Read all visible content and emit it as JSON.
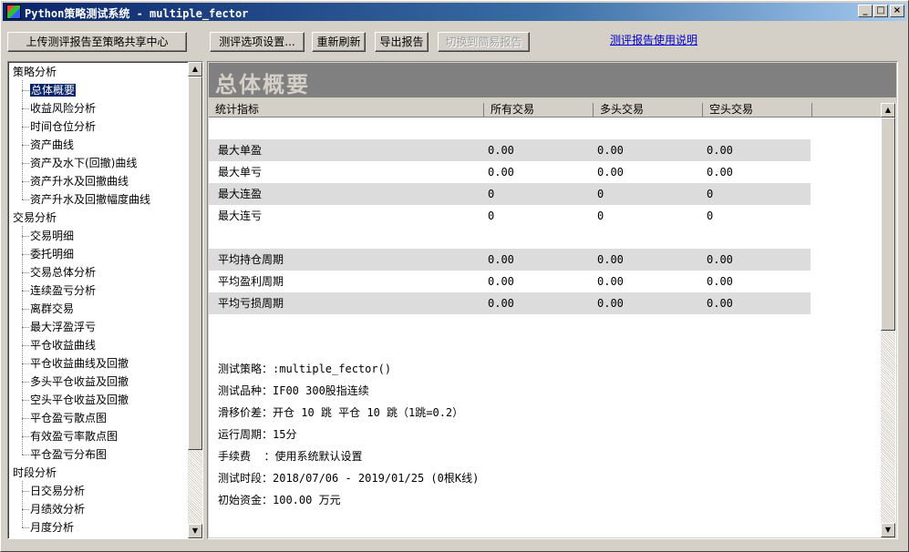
{
  "window": {
    "title": "Python策略测试系统 - multiple_fector"
  },
  "toolbar": {
    "upload_label": "上传测评报告至策略共享中心",
    "options_label": "测评选项设置...",
    "refresh_label": "重新刷新",
    "export_label": "导出报告",
    "simple_label": "切换到简易报告",
    "help_link": "测评报告使用说明"
  },
  "tree": {
    "groups": [
      {
        "label": "策略分析",
        "items": [
          "总体概要",
          "收益风险分析",
          "时间仓位分析",
          "资产曲线",
          "资产及水下(回撤)曲线",
          "资产升水及回撤曲线",
          "资产升水及回撤幅度曲线"
        ]
      },
      {
        "label": "交易分析",
        "items": [
          "交易明细",
          "委托明细",
          "交易总体分析",
          "连续盈亏分析",
          "离群交易",
          "最大浮盈浮亏",
          "平仓收益曲线",
          "平仓收益曲线及回撤",
          "多头平仓收益及回撤",
          "空头平仓收益及回撤",
          "平仓盈亏散点图",
          "有效盈亏率散点图",
          "平仓盈亏分布图"
        ]
      },
      {
        "label": "时段分析",
        "items": [
          "日交易分析",
          "月绩效分析",
          "月度分析"
        ]
      }
    ],
    "selected": "总体概要"
  },
  "panel": {
    "title": "总体概要"
  },
  "table": {
    "columns": [
      "统计指标",
      "所有交易",
      "多头交易",
      "空头交易"
    ],
    "rows": [
      {
        "name": "最大单盈",
        "all": "0.00",
        "long": "0.00",
        "short": "0.00"
      },
      {
        "name": "最大单亏",
        "all": "0.00",
        "long": "0.00",
        "short": "0.00"
      },
      {
        "name": "最大连盈",
        "all": "0",
        "long": "0",
        "short": "0"
      },
      {
        "name": "最大连亏",
        "all": "0",
        "long": "0",
        "short": "0"
      },
      {
        "name": "平均持仓周期",
        "all": "0.00",
        "long": "0.00",
        "short": "0.00"
      },
      {
        "name": "平均盈利周期",
        "all": "0.00",
        "long": "0.00",
        "short": "0.00"
      },
      {
        "name": "平均亏损周期",
        "all": "0.00",
        "long": "0.00",
        "short": "0.00"
      }
    ]
  },
  "info": [
    "测试策略：:multiple_fector()",
    "测试品种：IF00 300股指连续",
    "滑移价差：开仓 10 跳 平仓 10 跳（1跳=0.2）",
    "运行周期：15分",
    "手续费  ：使用系统默认设置",
    "测试时段：2018/07/06 - 2019/01/25 (0根K线)",
    "初始资金：100.00 万元"
  ],
  "icons": {
    "minimize": "minimize-icon",
    "maximize": "maximize-icon",
    "close": "close-icon",
    "scroll_up": "arrow-up-icon",
    "scroll_down": "arrow-down-icon"
  }
}
